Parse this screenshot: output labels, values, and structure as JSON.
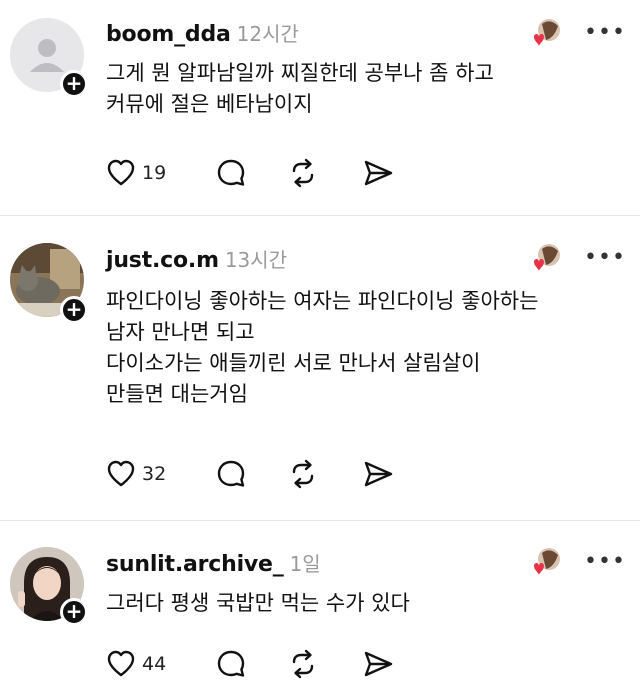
{
  "icons": {
    "like": "heart-outline-icon",
    "reply": "comment-bubble-icon",
    "repost": "repost-arrows-icon",
    "share": "send-paper-plane-icon",
    "more": "more-dots-icon",
    "follow": "plus-icon"
  },
  "colors": {
    "like_heart": "#e8334a",
    "time_text": "#9a9a9a"
  },
  "more_glyph": "•••",
  "posts": [
    {
      "username": "boom_dda",
      "time": "12시간",
      "lines": [
        "그게 뭔 알파남일까 찌질한데 공부나 좀 하고",
        "커뮤에 절은 베타남이지"
      ],
      "likes": "19"
    },
    {
      "username": "just.co.m",
      "time": "13시간",
      "lines": [
        "파인다이닝 좋아하는 여자는 파인다이닝 좋아하는",
        "남자 만나면 되고",
        "다이소가는 애들끼린 서로 만나서 살림살이",
        "만들면 대는거임"
      ],
      "likes": "32"
    },
    {
      "username": "sunlit.archive_",
      "time": "1일",
      "lines": [
        "그러다 평생 국밥만 먹는 수가 있다"
      ],
      "likes": "44"
    }
  ]
}
